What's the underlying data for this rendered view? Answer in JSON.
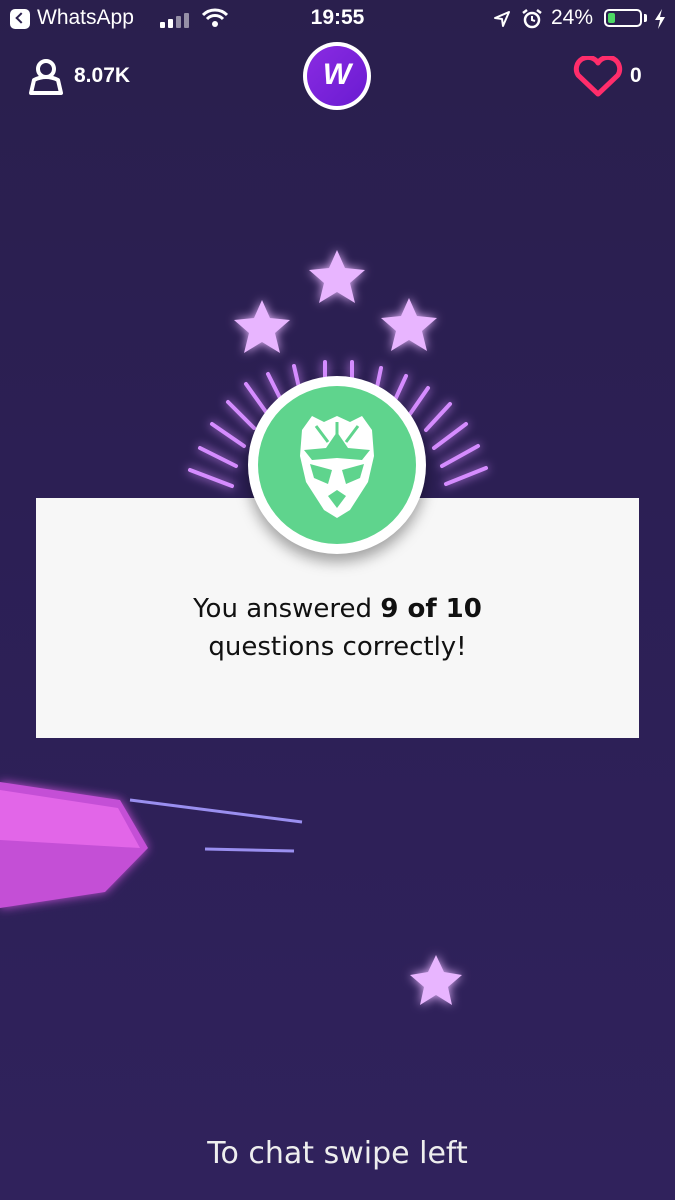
{
  "status_bar": {
    "back_app": "WhatsApp",
    "time": "19:55",
    "battery_percent": "24%",
    "battery_level": 0.24
  },
  "header": {
    "viewers": "8.07K",
    "lives": "0",
    "logo_letter": "W"
  },
  "result": {
    "prefix": "You answered ",
    "score": "9 of 10",
    "suffix": "questions correctly!"
  },
  "footer": {
    "hint": "To chat swipe left"
  },
  "colors": {
    "background": "#2c1f55",
    "badge_green": "#5fd48d",
    "star_glow": "#e3a6ff",
    "heart": "#ff2d6b"
  }
}
